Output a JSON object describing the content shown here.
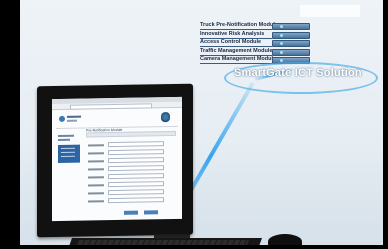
{
  "modules": [
    "Truck Pre-Notification Module",
    "Innovative Risk Analysis",
    "Access Control Module",
    "Traffic Management Module",
    "Camera Management Module"
  ],
  "solution_label": "SmartGate ICT Solution",
  "monitor": {
    "page_title": "Pre-Notification Module"
  },
  "colors": {
    "beam": "#2da0f0",
    "panel": "#2d65a2",
    "server": "#4a7196"
  }
}
